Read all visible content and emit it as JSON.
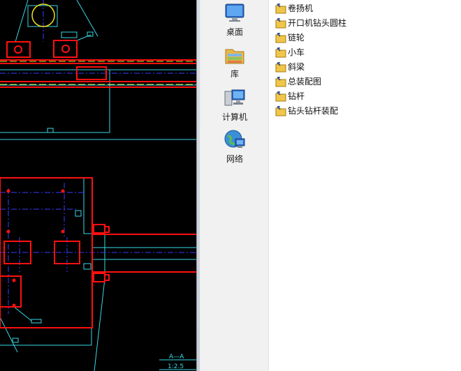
{
  "drawing": {
    "section_label": "A—A",
    "scale_label": "1:2.5"
  },
  "nav": {
    "items": [
      {
        "label": "桌面",
        "icon": "desktop-icon"
      },
      {
        "label": "库",
        "icon": "library-icon"
      },
      {
        "label": "计算机",
        "icon": "computer-icon"
      },
      {
        "label": "网络",
        "icon": "network-icon"
      }
    ]
  },
  "files": {
    "items": [
      {
        "name": "卷扬机",
        "icon": "dwg-file-icon"
      },
      {
        "name": "开口机钻头圆柱",
        "icon": "dwg-file-icon"
      },
      {
        "name": "链轮",
        "icon": "dwg-file-icon"
      },
      {
        "name": "小车",
        "icon": "dwg-file-icon"
      },
      {
        "name": "斜梁",
        "icon": "dwg-file-icon"
      },
      {
        "name": "总装配图",
        "icon": "dwg-file-icon"
      },
      {
        "name": "钻杆",
        "icon": "dwg-file-icon"
      },
      {
        "name": "钻头钻杆装配",
        "icon": "dwg-file-icon"
      }
    ]
  },
  "colors": {
    "cad_background": "#000000",
    "cad_red": "#ff1010",
    "cad_cyan": "#38d8e6",
    "cad_blue": "#3a3aff",
    "cad_yellow": "#f0e020"
  }
}
